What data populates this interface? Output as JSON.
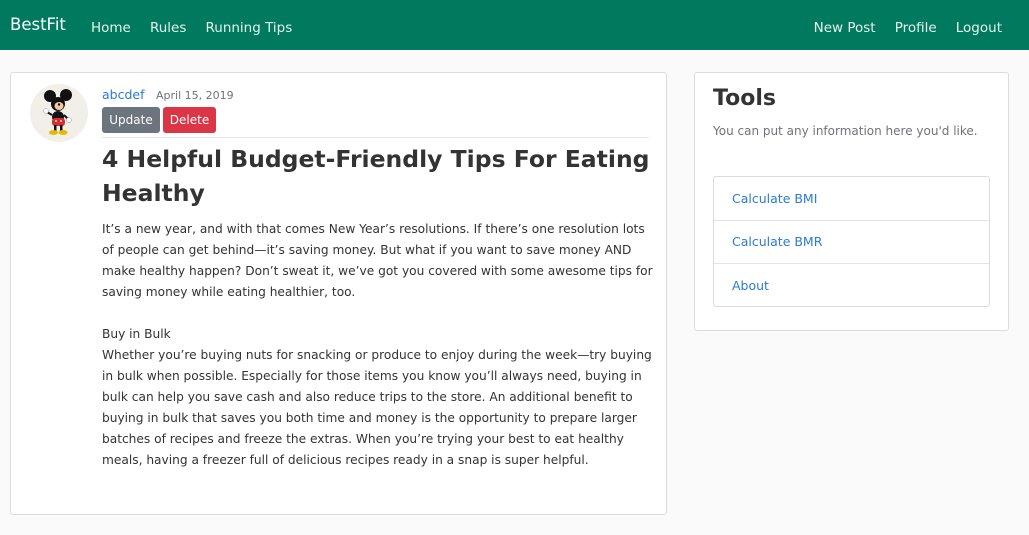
{
  "navbar": {
    "brand": "BestFit",
    "left_links": [
      "Home",
      "Rules",
      "Running Tips"
    ],
    "right_links": [
      "New Post",
      "Profile",
      "Logout"
    ],
    "background_color": "#007a5e"
  },
  "post": {
    "author": "abcdef",
    "date": "April 15, 2019",
    "avatar_icon": "mickey-mouse-icon",
    "update_label": "Update",
    "delete_label": "Delete",
    "title": "4 Helpful Budget-Friendly Tips For Eating Healthy",
    "intro": "It’s a new year, and with that comes New Year’s resolutions. If there’s one resolution lots of people can get behind—it’s saving money. But what if you want to save money AND make healthy happen? Don’t sweat it, we’ve got you covered with some awesome tips for saving money while eating healthier, too.",
    "section_heading": "Buy in Bulk",
    "section_body": "Whether you’re buying nuts for snacking or produce to enjoy during the week—try buying in bulk when possible. Especially for those items you know you’ll always need, buying in bulk can help you save cash and also reduce trips to the store. An additional benefit to buying in bulk that saves you both time and money is the opportunity to prepare larger batches of recipes and freeze the extras. When you’re trying your best to eat healthy meals, having a freezer full of delicious recipes ready in a snap is super helpful."
  },
  "tools": {
    "title": "Tools",
    "description": "You can put any information here you'd like.",
    "items": [
      "Calculate BMI",
      "Calculate BMR",
      "About"
    ]
  },
  "colors": {
    "link": "#2a7bd2",
    "update_button": "#6c757d",
    "delete_button": "#dc3545"
  }
}
